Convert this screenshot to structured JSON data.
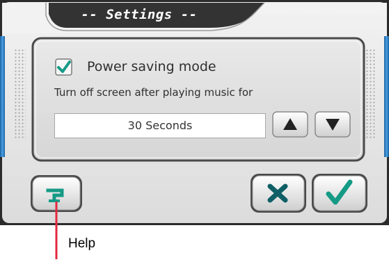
{
  "dialog": {
    "title": "-- Settings --"
  },
  "settings": {
    "power_saving": {
      "label": "Power saving mode",
      "checked": true
    },
    "description": "Turn off screen after playing music for",
    "timeout_value": "30 Seconds"
  },
  "buttons": {
    "up_icon": "triangle-up-icon",
    "down_icon": "triangle-down-icon",
    "help_icon": "question-mark-icon",
    "cancel_icon": "x-icon",
    "ok_icon": "checkmark-icon"
  },
  "annotation": {
    "help_label": "Help"
  },
  "colors": {
    "title_tab": "#333333",
    "accent_teal": "#159a86",
    "side_rail_blue": "#2f86cf",
    "annotation_line": "#e22a40"
  }
}
